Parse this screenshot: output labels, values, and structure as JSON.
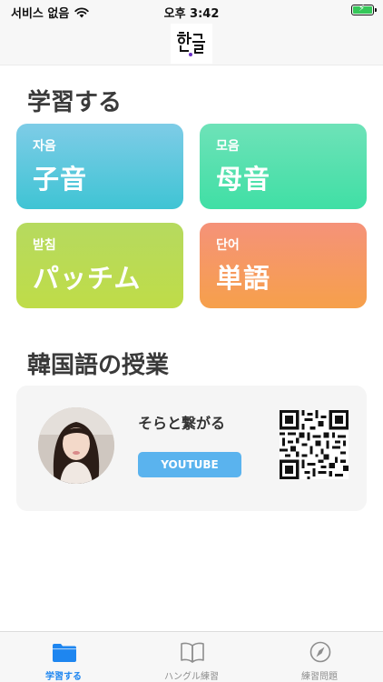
{
  "status_bar": {
    "carrier": "서비스 없음",
    "time": "오후 3:42",
    "battery_color": "#35c759"
  },
  "header": {
    "logo_text": "한글"
  },
  "learn_section": {
    "title": "学習する",
    "cards": [
      {
        "korean": "자음",
        "japanese": "子音",
        "color_top": "#7ecce7",
        "color_bottom": "#3fc4d4"
      },
      {
        "korean": "모음",
        "japanese": "母音",
        "color_top": "#6ee2b8",
        "color_bottom": "#40dfa5"
      },
      {
        "korean": "받침",
        "japanese": "パッチム",
        "color_top": "#b6da5f",
        "color_bottom": "#bfdc48"
      },
      {
        "korean": "단어",
        "japanese": "単語",
        "color_top": "#f59279",
        "color_bottom": "#f6a04b"
      }
    ]
  },
  "class_section": {
    "title": "韓国語の授業",
    "channel_name": "そらと繋がる",
    "button_label": "YOUTUBE",
    "button_color": "#5ab3ee"
  },
  "tab_bar": {
    "accent": "#1e86f0",
    "tabs": [
      {
        "label": "学習する",
        "icon": "folder-icon",
        "active": true
      },
      {
        "label": "ハングル練習",
        "icon": "book-icon",
        "active": false
      },
      {
        "label": "練習問題",
        "icon": "compass-icon",
        "active": false
      }
    ]
  }
}
